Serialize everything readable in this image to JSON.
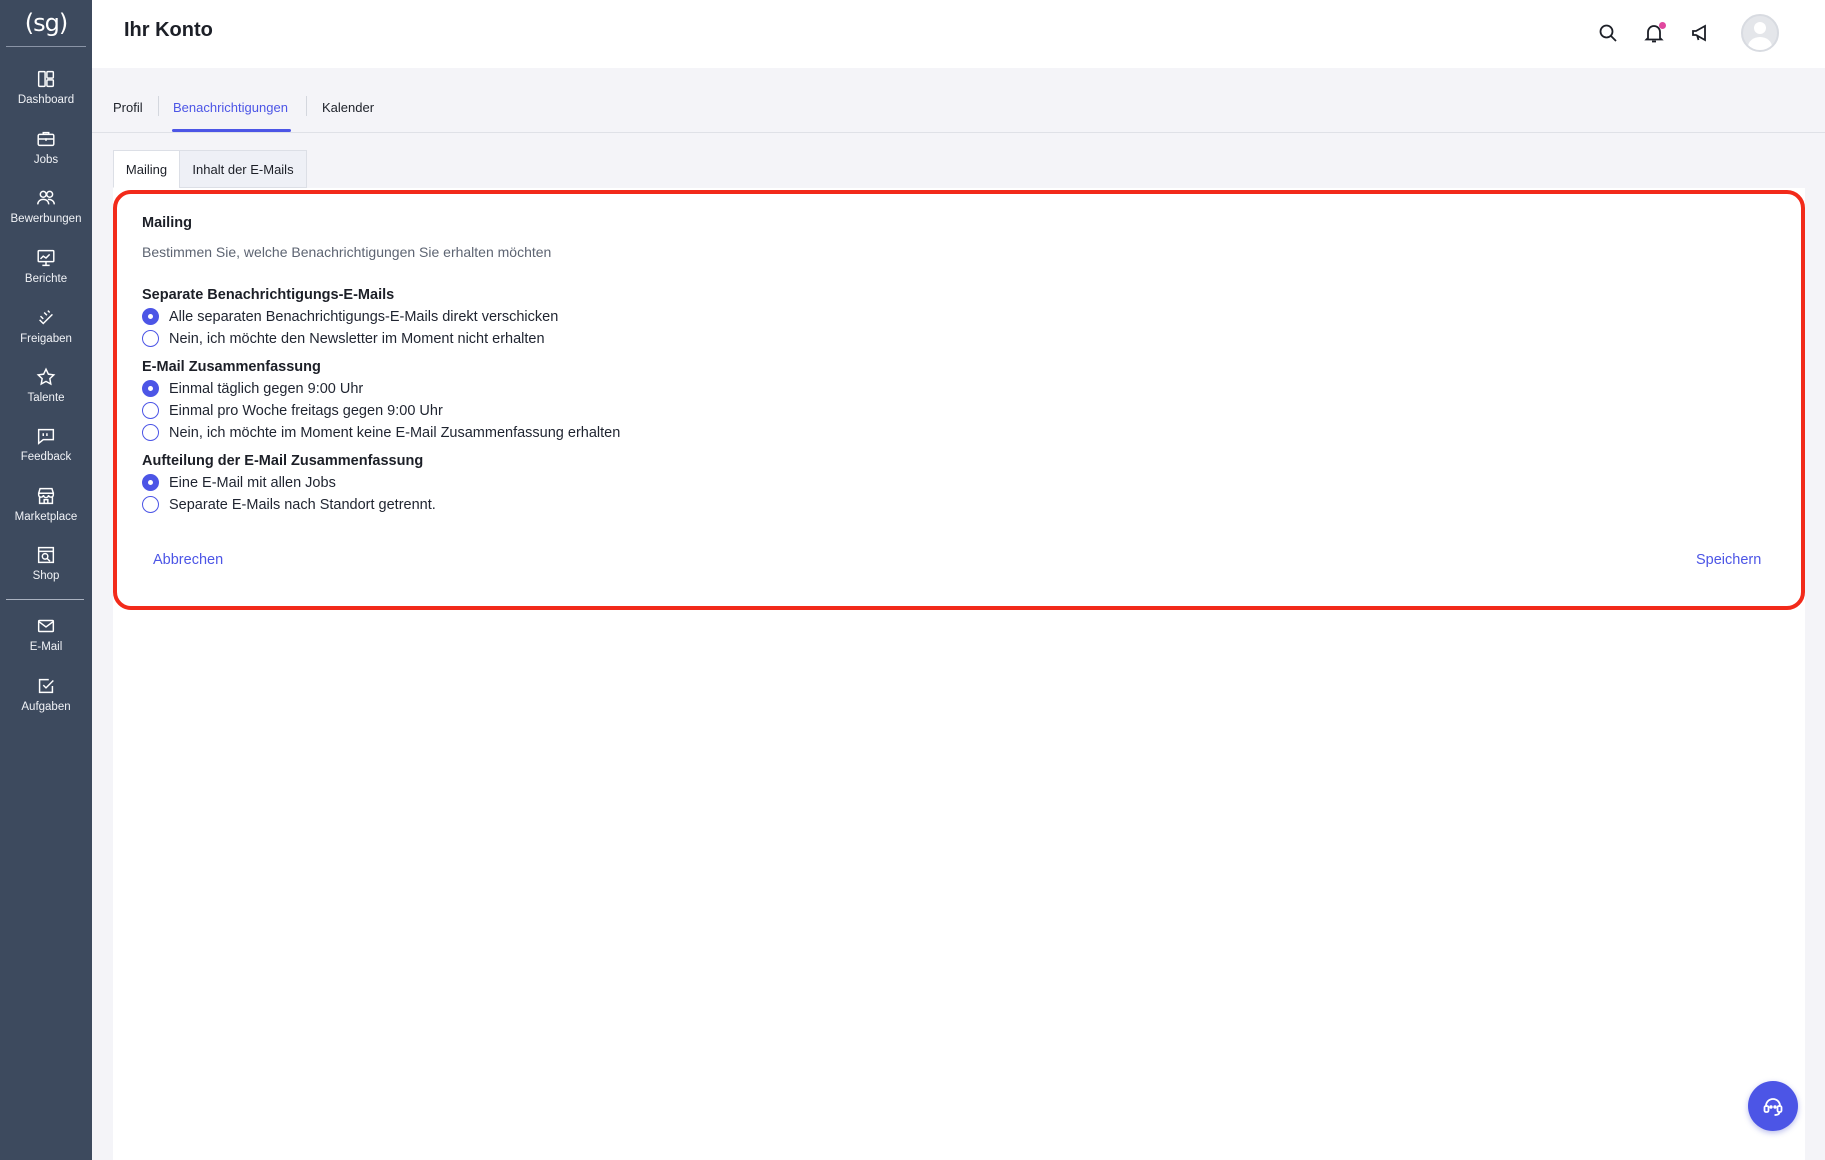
{
  "sidebar": {
    "logo": "(sg)",
    "items": [
      {
        "label": "Dashboard",
        "icon": "dashboard-icon"
      },
      {
        "label": "Jobs",
        "icon": "briefcase-icon"
      },
      {
        "label": "Bewerbungen",
        "icon": "users-icon"
      },
      {
        "label": "Berichte",
        "icon": "chart-board-icon"
      },
      {
        "label": "Freigaben",
        "icon": "approval-hand-icon"
      },
      {
        "label": "Talente",
        "icon": "star-icon"
      },
      {
        "label": "Feedback",
        "icon": "quote-bubble-icon"
      },
      {
        "label": "Marketplace",
        "icon": "store-icon"
      },
      {
        "label": "Shop",
        "icon": "shop-search-icon"
      },
      {
        "label": "E-Mail",
        "icon": "mail-icon"
      },
      {
        "label": "Aufgaben",
        "icon": "checkbox-icon"
      }
    ]
  },
  "header": {
    "title": "Ihr Konto",
    "icons": [
      "search-icon",
      "bell-icon",
      "megaphone-icon",
      "avatar",
      "chevron-down-icon"
    ],
    "accent": "#4c55e6",
    "notification_dot_color": "#e0479e"
  },
  "tabs": [
    {
      "label": "Profil",
      "active": false
    },
    {
      "label": "Benachrichtigungen",
      "active": true
    },
    {
      "label": "Kalender",
      "active": false
    }
  ],
  "subtabs": [
    {
      "label": "Mailing",
      "active": true
    },
    {
      "label": "Inhalt der E-Mails",
      "active": false
    }
  ],
  "card": {
    "title": "Mailing",
    "description": "Bestimmen Sie, welche Benachrichtigungen Sie erhalten möchten",
    "groups": [
      {
        "title": "Separate Benachrichtigungs-E-Mails",
        "options": [
          {
            "label": "Alle separaten Benachrichtigungs-E-Mails direkt verschicken",
            "selected": true
          },
          {
            "label": "Nein, ich möchte den Newsletter im Moment nicht erhalten",
            "selected": false
          }
        ]
      },
      {
        "title": "E-Mail Zusammenfassung",
        "options": [
          {
            "label": "Einmal täglich gegen 9:00 Uhr",
            "selected": true
          },
          {
            "label": "Einmal pro Woche freitags gegen 9:00 Uhr",
            "selected": false
          },
          {
            "label": "Nein, ich möchte im Moment keine E-Mail Zusammenfassung erhalten",
            "selected": false
          }
        ]
      },
      {
        "title": "Aufteilung der E-Mail Zusammenfassung",
        "options": [
          {
            "label": "Eine E-Mail mit allen Jobs",
            "selected": true
          },
          {
            "label": "Separate E-Mails nach Standort getrennt.",
            "selected": false
          }
        ]
      }
    ],
    "cancel_label": "Abbrechen",
    "save_label": "Speichern",
    "highlight_color": "#f22a1a"
  },
  "help_button": {
    "icon": "support-headset-icon"
  }
}
